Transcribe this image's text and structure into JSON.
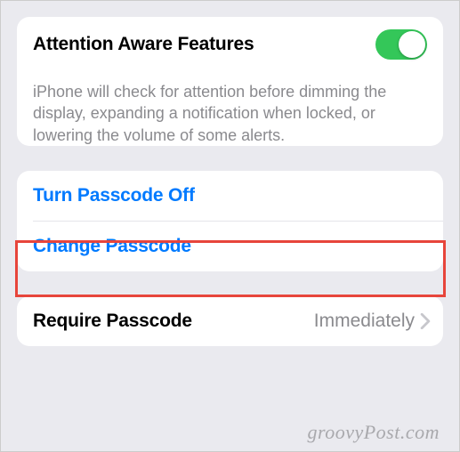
{
  "attention": {
    "title": "Attention Aware Features",
    "toggle_on": true,
    "description": "iPhone will check for attention before dimming the display, expanding a notification when locked, or lowering the volume of some alerts."
  },
  "passcode": {
    "turn_off_label": "Turn Passcode Off",
    "change_label": "Change Passcode"
  },
  "require": {
    "label": "Require Passcode",
    "value": "Immediately"
  },
  "watermark": "groovyPost.com"
}
